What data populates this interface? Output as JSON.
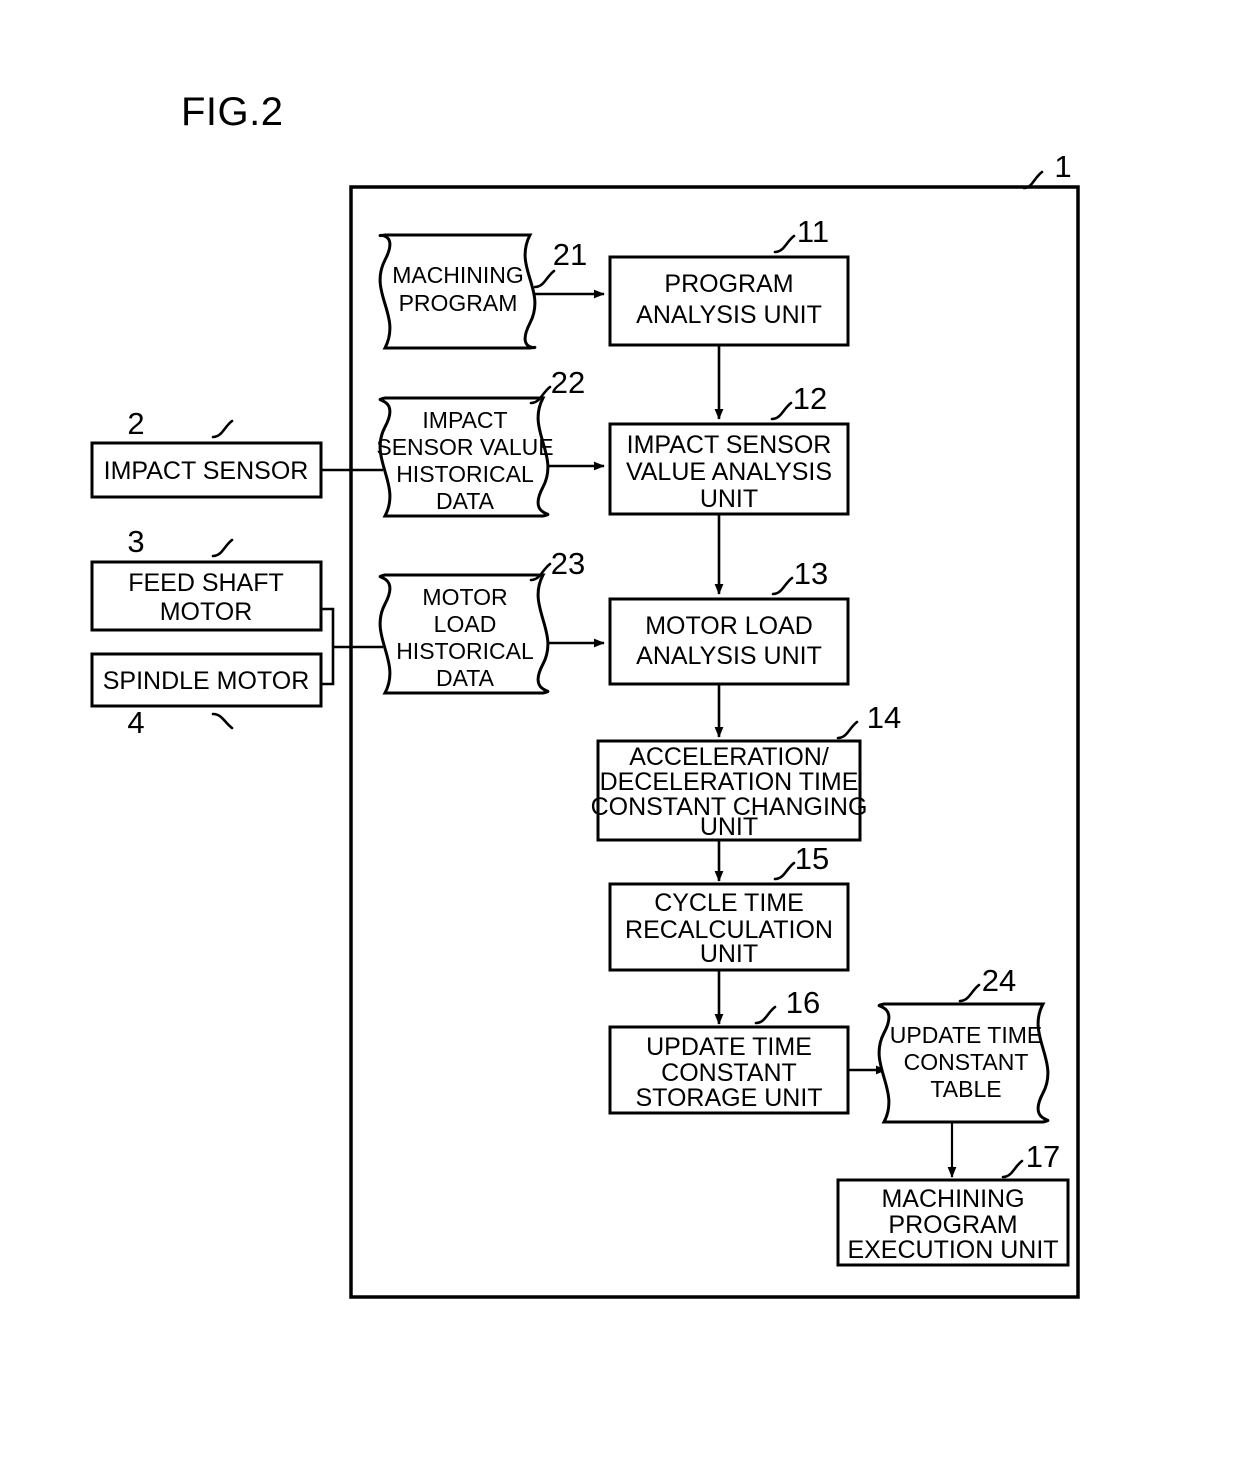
{
  "figure": {
    "title": "FIG.2"
  },
  "system": {
    "ref": "1"
  },
  "external_blocks": [
    {
      "id": "impact-sensor",
      "ref": "2",
      "lines": [
        "IMPACT SENSOR"
      ]
    },
    {
      "id": "feed-shaft-motor",
      "ref": "3",
      "lines": [
        "FEED SHAFT",
        "MOTOR"
      ]
    },
    {
      "id": "spindle-motor",
      "ref": "4",
      "lines": [
        "SPINDLE MOTOR"
      ]
    }
  ],
  "documents": [
    {
      "id": "machining-program",
      "ref": "21",
      "lines": [
        "MACHINING",
        "PROGRAM"
      ]
    },
    {
      "id": "impact-sensor-value-historical-data",
      "ref": "22",
      "lines": [
        "IMPACT",
        "SENSOR VALUE",
        "HISTORICAL",
        "DATA"
      ]
    },
    {
      "id": "motor-load-historical-data",
      "ref": "23",
      "lines": [
        "MOTOR",
        "LOAD",
        "HISTORICAL",
        "DATA"
      ]
    },
    {
      "id": "update-time-constant-table",
      "ref": "24",
      "lines": [
        "UPDATE TIME",
        "CONSTANT",
        "TABLE"
      ]
    }
  ],
  "units": [
    {
      "id": "program-analysis-unit",
      "ref": "11",
      "lines": [
        "PROGRAM",
        "ANALYSIS UNIT"
      ]
    },
    {
      "id": "impact-sensor-value-analysis-unit",
      "ref": "12",
      "lines": [
        "IMPACT SENSOR",
        "VALUE ANALYSIS",
        "UNIT"
      ]
    },
    {
      "id": "motor-load-analysis-unit",
      "ref": "13",
      "lines": [
        "MOTOR LOAD",
        "ANALYSIS UNIT"
      ]
    },
    {
      "id": "accel-decel-time-constant-changing-unit",
      "ref": "14",
      "lines": [
        "ACCELERATION/",
        "DECELERATION TIME",
        "CONSTANT CHANGING",
        "UNIT"
      ]
    },
    {
      "id": "cycle-time-recalculation-unit",
      "ref": "15",
      "lines": [
        "CYCLE TIME",
        "RECALCULATION",
        "UNIT"
      ]
    },
    {
      "id": "update-time-constant-storage-unit",
      "ref": "16",
      "lines": [
        "UPDATE TIME",
        "CONSTANT",
        "STORAGE UNIT"
      ]
    },
    {
      "id": "machining-program-execution-unit",
      "ref": "17",
      "lines": [
        "MACHINING",
        "PROGRAM",
        "EXECUTION UNIT"
      ]
    }
  ],
  "colors": {
    "ink": "#000000",
    "paper": "#ffffff"
  }
}
